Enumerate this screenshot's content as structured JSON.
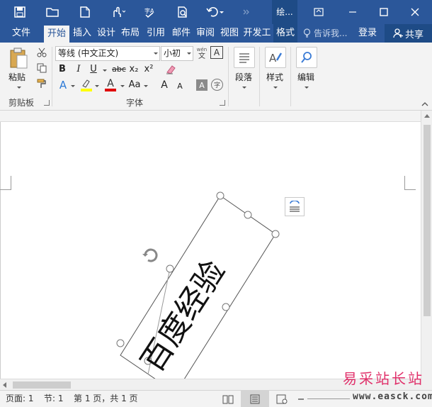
{
  "title_bar": {
    "context_tab_title": "绘...",
    "colors": {
      "brand": "#2b579a",
      "brand_dark": "#1e4b86"
    }
  },
  "tabs": [
    {
      "label": "文件"
    },
    {
      "label": "开始",
      "active": true
    },
    {
      "label": "插入"
    },
    {
      "label": "设计"
    },
    {
      "label": "布局"
    },
    {
      "label": "引用"
    },
    {
      "label": "邮件"
    },
    {
      "label": "审阅"
    },
    {
      "label": "视图"
    },
    {
      "label": "开发工"
    },
    {
      "label": "格式"
    }
  ],
  "tell_me": {
    "placeholder": "告诉我..."
  },
  "account": {
    "login": "登录",
    "share": "共享"
  },
  "ribbon": {
    "clipboard": {
      "paste": "粘贴",
      "group_label": "剪贴板"
    },
    "font": {
      "font_name": "等线 (中文正文)",
      "font_size": "小初",
      "wen_top": "wén",
      "wen_bottom": "文",
      "font_color_box": "A",
      "bold": "B",
      "italic": "I",
      "underline": "U",
      "strike": "abc",
      "subscript": "x₂",
      "superscript": "x²",
      "text_effect": "A",
      "font_color": "A",
      "change_case": "Aa",
      "grow": "A",
      "shrink": "A",
      "char_shading": "A",
      "enclose": "字",
      "group_label": "字体",
      "highlight_color": "#ffff00",
      "font_color_value": "#e00000"
    },
    "paragraph": {
      "label": "段落"
    },
    "styles": {
      "label": "样式"
    },
    "editing": {
      "label": "编辑"
    }
  },
  "document": {
    "textbox_text": "百度经验"
  },
  "status_bar": {
    "page": "页面: 1",
    "section": "节: 1",
    "page_of": "第 1 页，共 1 页"
  },
  "watermark": {
    "text": "易采站长站",
    "url": "www.easck.com"
  }
}
